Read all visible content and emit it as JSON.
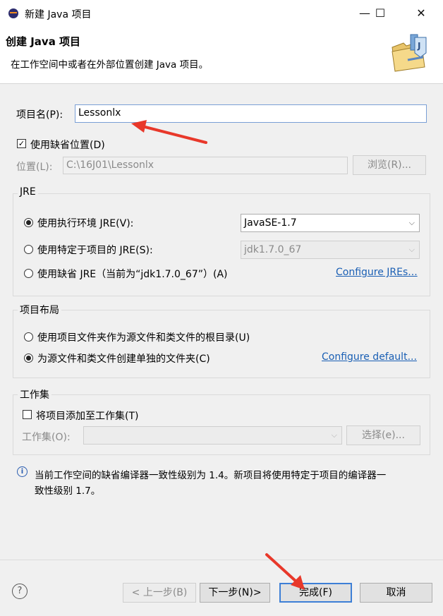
{
  "window": {
    "title": "新建 Java 项目",
    "minimize": "—",
    "maximize": "☐",
    "close": "✕"
  },
  "header": {
    "title": "创建 Java 项目",
    "description": "在工作空间中或者在外部位置创建 Java 项目。"
  },
  "project_name": {
    "label": "项目名(P):",
    "value": "Lessonlx"
  },
  "use_default_location": {
    "label": "使用缺省位置(D)",
    "checked": true
  },
  "location": {
    "label": "位置(L):",
    "value": "C:\\16J01\\Lessonlx",
    "browse_label": "浏览(R)..."
  },
  "jre": {
    "title": "JRE",
    "option_env": "使用执行环境 JRE(V):",
    "env_value": "JavaSE-1.7",
    "option_specific": "使用特定于项目的 JRE(S):",
    "specific_value": "jdk1.7.0_67",
    "option_default": "使用缺省 JRE（当前为“jdk1.7.0_67”）(A)",
    "configure_link": "Configure JREs..."
  },
  "layout": {
    "title": "项目布局",
    "option_root": "使用项目文件夹作为源文件和类文件的根目录(U)",
    "option_separate": "为源文件和类文件创建单独的文件夹(C)",
    "configure_link": "Configure default..."
  },
  "working_sets": {
    "title": "工作集",
    "add_label": "将项目添加至工作集(T)",
    "sets_label": "工作集(O):",
    "select_label": "选择(e)..."
  },
  "info": {
    "line1": "当前工作空间的缺省编译器一致性级别为 1.4。新项目将使用特定于项目的编译器一",
    "line2": "致性级别 1.7。"
  },
  "footer": {
    "help": "?",
    "back": "< 上一步(B)",
    "next": "下一步(N)>",
    "finish": "完成(F)",
    "cancel": "取消"
  },
  "icons": [
    "java-project-wizard-icon",
    "info-icon",
    "help-icon",
    "chevron-down-icon",
    "red-arrow-annotation"
  ],
  "colors": {
    "link": "#1a5fb4",
    "annotation": "#e8382a",
    "focus_border": "#3d7fd6"
  }
}
